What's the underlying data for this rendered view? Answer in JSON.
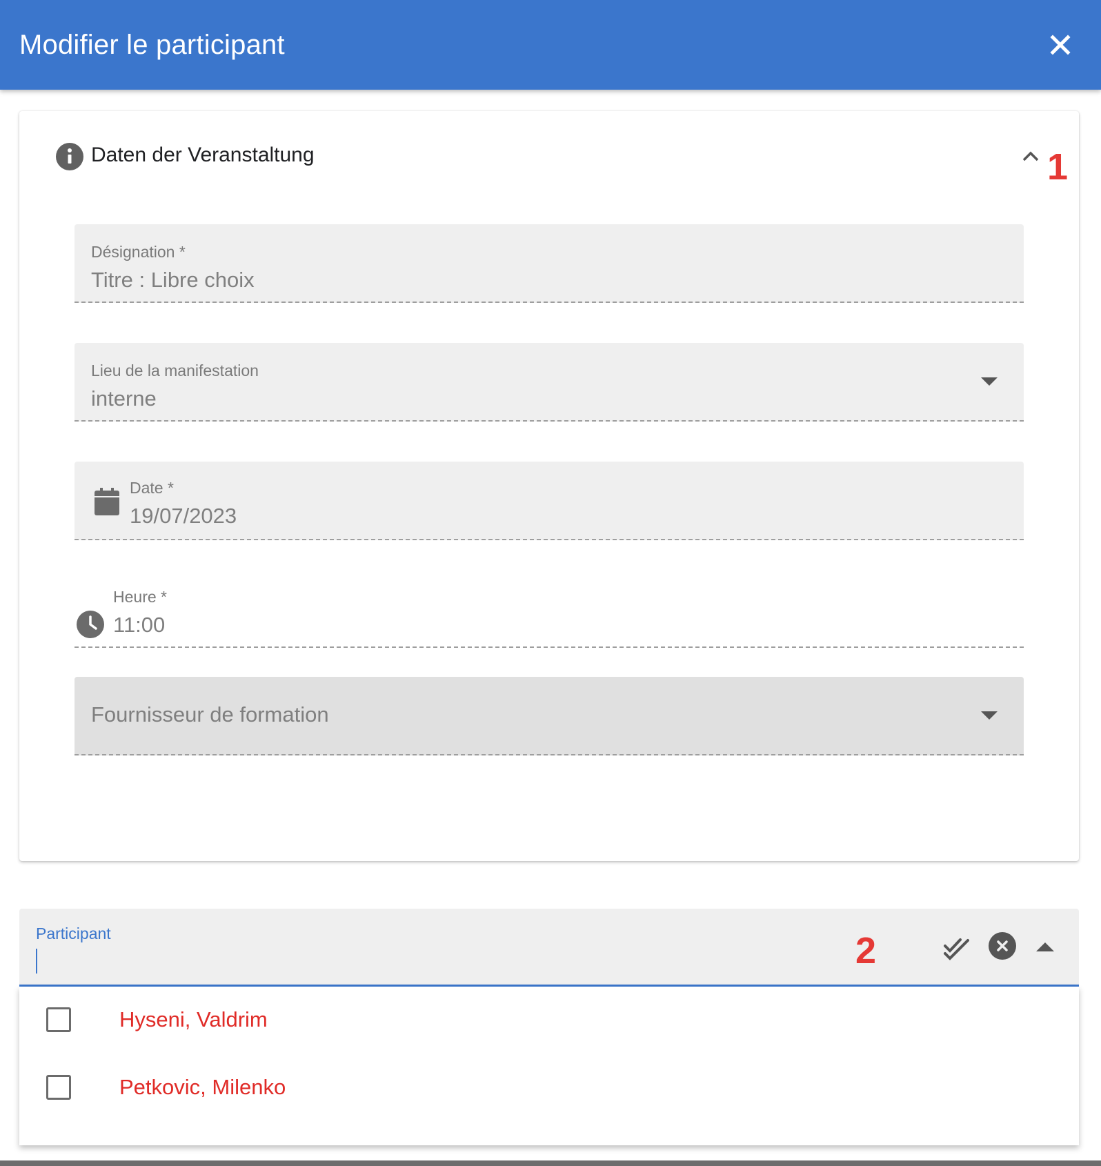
{
  "colors": {
    "primary": "#3b76cc",
    "danger": "#e02b27",
    "annotation": "#e53935"
  },
  "dialog": {
    "title": "Modifier le participant",
    "close_icon": "close-icon"
  },
  "section": {
    "title": "Daten der Veranstaltung",
    "icon": "info-icon",
    "toggle_icon": "chevron-up-icon",
    "expanded": true
  },
  "form": {
    "designation": {
      "label": "Désignation *",
      "value": "Titre : Libre choix"
    },
    "lieu": {
      "label": "Lieu de la manifestation",
      "value": "interne"
    },
    "date": {
      "label": "Date *",
      "value": "19/07/2023",
      "icon": "calendar-icon"
    },
    "heure": {
      "label": "Heure *",
      "value": "11:00",
      "icon": "clock-icon"
    },
    "fournisseur": {
      "placeholder": "Fournisseur de formation"
    }
  },
  "participant": {
    "label": "Participant",
    "value": "",
    "select_all_icon": "double-check-icon",
    "clear_icon": "clear-circle-icon",
    "toggle_icon": "caret-up-icon",
    "options": [
      {
        "label": "Hyseni, Valdrim",
        "checked": false
      },
      {
        "label": "Petkovic, Milenko",
        "checked": false
      }
    ]
  },
  "annotations": [
    "1",
    "2"
  ]
}
